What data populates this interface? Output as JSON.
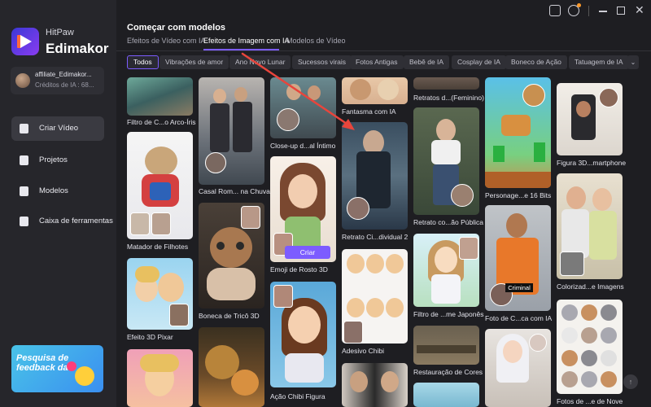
{
  "app": {
    "brand_top": "HitPaw",
    "brand_bottom": "Edimakor",
    "account_name": "affiliate_Edimakor...",
    "account_credits": "Créditos de IA : 68..."
  },
  "sidebar": {
    "items": [
      {
        "label": "Criar Vídeo",
        "active": true
      },
      {
        "label": "Projetos"
      },
      {
        "label": "Modelos"
      },
      {
        "label": "Caixa de ferramentas"
      }
    ],
    "feedback": "Pesquisa de feedback da"
  },
  "header": {
    "title": "Começar com modelos",
    "tabs": [
      {
        "label": "Efeitos de Vídeo com IA"
      },
      {
        "label": "Efeitos de Imagem com IA",
        "active": true
      },
      {
        "label": "Modelos de Vídeo"
      }
    ]
  },
  "filters": [
    "Todos",
    "Vibrações de amor",
    "Ano Novo Lunar",
    "Sucessos virais",
    "Fotos Antigas",
    "Bebê de IA",
    "Cosplay de IA",
    "Boneco de Ação",
    "Tatuagem de IA"
  ],
  "cards": {
    "c1": "Filtro de C...o Arco-Íris",
    "c2": "Matador de Filhotes",
    "c3": "Efeito 3D Pixar",
    "c4": "Casal Rom... na Chuva",
    "c5": "Boneca de Tricô 3D",
    "c6": "Close-up d...al Íntimo",
    "c7": "Emoji de Rosto 3D",
    "c8": "Ação Chibi Figura",
    "c9": "Fantasma com IA",
    "c10": "Retrato Ci...dividual 2",
    "c11": "Adesivo Chibi",
    "c12": "Retratos d...(Feminino)",
    "c13": "Retrato co...ão Pública",
    "c14": "Filtro de ...me Japonês",
    "c15": "Restauração de Cores",
    "c16": "Personage...e 16 Bits",
    "c17": "Foto de C...ca com IA",
    "c18": "Figura 3D...martphone",
    "c19": "Colorizad...e Imagens",
    "c20": "Fotos de ...e de Nove"
  },
  "buttons": {
    "criar": "Criar",
    "criminal_label": "Criminal"
  },
  "colors": {
    "accent": "#7c5cff",
    "arrow": "#e8453c"
  }
}
